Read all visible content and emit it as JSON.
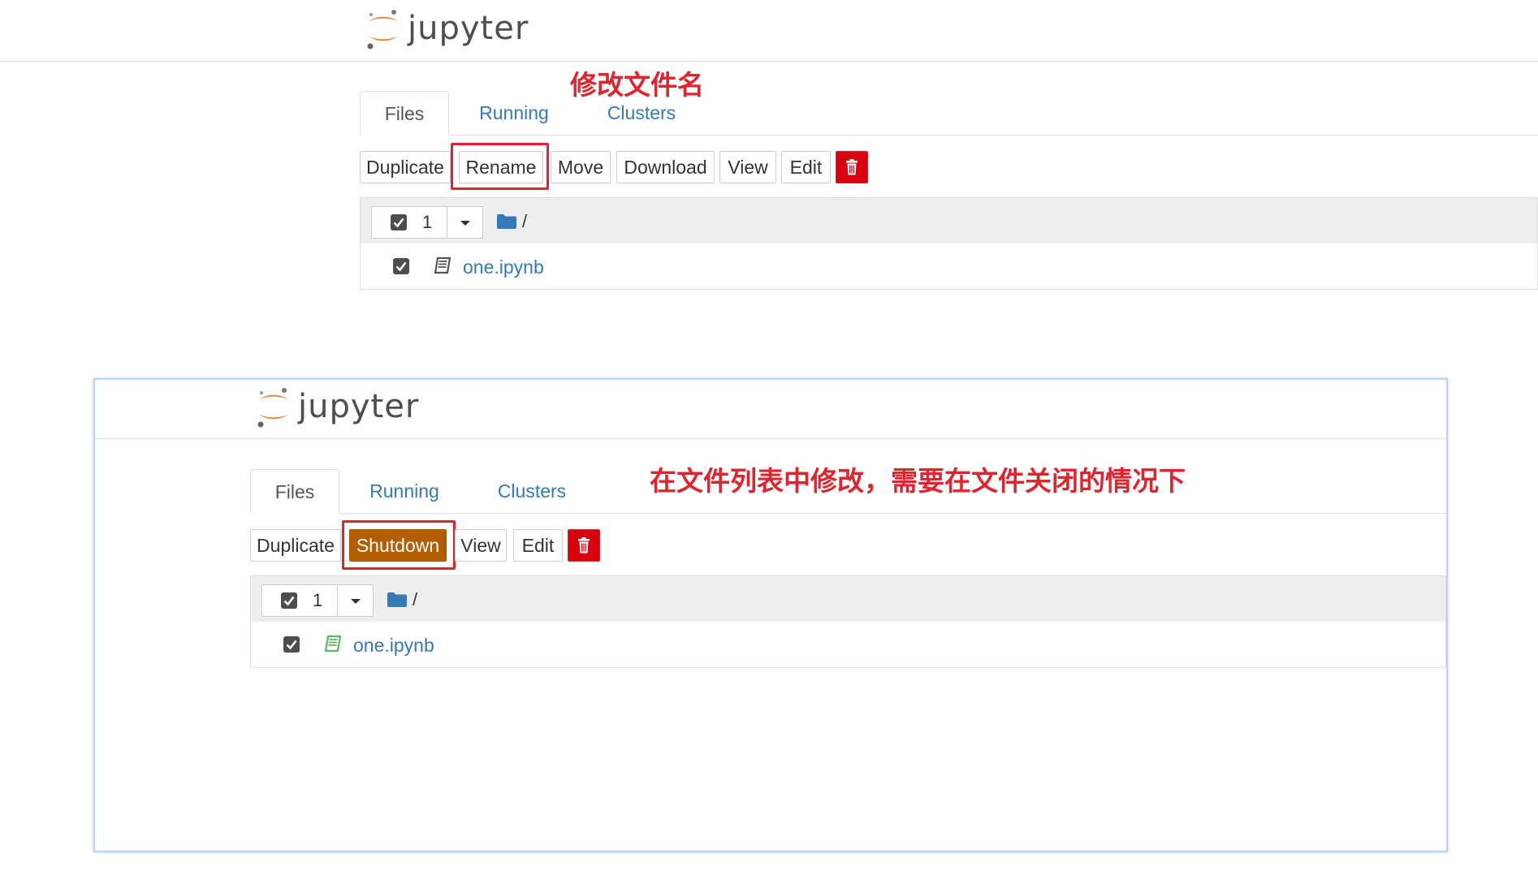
{
  "app": {
    "brand": "jupyter"
  },
  "top": {
    "annotation": "修改文件名",
    "tabs": [
      "Files",
      "Running",
      "Clusters"
    ],
    "buttons": {
      "duplicate": "Duplicate",
      "rename": "Rename",
      "move": "Move",
      "download": "Download",
      "view": "View",
      "edit": "Edit"
    },
    "list": {
      "selected_count": "1",
      "path": "/",
      "file": "one.ipynb"
    }
  },
  "bottom": {
    "annotation": "在文件列表中修改，需要在文件关闭的情况下",
    "tabs": [
      "Files",
      "Running",
      "Clusters"
    ],
    "buttons": {
      "duplicate": "Duplicate",
      "shutdown": "Shutdown",
      "view": "View",
      "edit": "Edit"
    },
    "list": {
      "selected_count": "1",
      "path": "/",
      "file": "one.ipynb"
    }
  },
  "colors": {
    "annotation": "#e0242e",
    "link": "#337ab7",
    "danger": "#d9000f",
    "shutdown": "#b35e00",
    "notebook_closed_icon": "#555555",
    "notebook_running_icon": "#5cb85c"
  },
  "icons": [
    "jupyter-logo-icon",
    "trash-icon",
    "checkbox-checked-icon",
    "caret-down-icon",
    "folder-icon",
    "notebook-icon"
  ]
}
